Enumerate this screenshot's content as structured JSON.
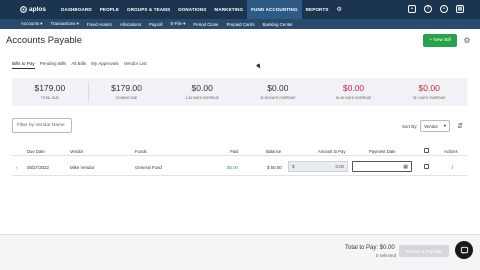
{
  "brand": {
    "name": "aplos"
  },
  "topnav": {
    "items": [
      "DASHBOARD",
      "PEOPLE",
      "GROUPS & TEAMS",
      "DONATIONS",
      "MARKETING",
      "FUND ACCOUNTING",
      "REPORTS"
    ],
    "active": "FUND ACCOUNTING",
    "right_icons": [
      "plus-icon",
      "help-icon",
      "user-icon",
      "grid-icon"
    ]
  },
  "subnav": {
    "items": [
      "Accounts ▾",
      "Transactions ▾",
      "Fixed Assets",
      "Allocations",
      "Payroll",
      "E-File ▾",
      "Period Close",
      "Prepaid Cards",
      "Banking Center"
    ]
  },
  "page": {
    "title": "Accounts Payable",
    "new_bill_label": "+ New Bill"
  },
  "tabs": [
    "Bills to Pay",
    "Pending Bills",
    "All Bills",
    "My Approvals",
    "Vendor List"
  ],
  "active_tab": "Bills to Pay",
  "summary": [
    {
      "value": "$179.00",
      "label": "TOTAL DUE",
      "color": "#333333"
    },
    {
      "value": "$179.00",
      "label": "COMING DUE",
      "color": "#333333"
    },
    {
      "value": "$0.00",
      "label": "1-30 DAYS OVERDUE",
      "color": "#333333"
    },
    {
      "value": "$0.00",
      "label": "31-60 DAYS OVERDUE",
      "color": "#333333"
    },
    {
      "value": "$0.00",
      "label": "61-90 DAYS OVERDUE",
      "color": "#d4213d"
    },
    {
      "value": "$0.00",
      "label": "91+ DAYS OVERDUE",
      "color": "#d4213d"
    }
  ],
  "filter": {
    "placeholder": "Filter by Vendor Name"
  },
  "sort": {
    "label": "Sort By:",
    "value": "Vendor"
  },
  "table": {
    "columns": [
      "Due Date",
      "Vendor",
      "Funds",
      "Paid",
      "Balance",
      "Amount to Pay",
      "Payment Date",
      "Actions"
    ],
    "rows": [
      {
        "due_date": "05/27/2022",
        "vendor": "Mike Vendor",
        "funds": "General Fund",
        "paid": "$0.00",
        "balance": "$ 50.00",
        "amount_prefix": "$",
        "amount": "0.00",
        "payment_date": ""
      }
    ]
  },
  "footer": {
    "total_label": "Total to Pay: $0.00",
    "selected_label": "0 selected",
    "review_button": "Review & Pay Bills"
  },
  "colors": {
    "nav_bg": "#1b3550",
    "accent_green": "#27a34a",
    "alert_red": "#d4213d"
  }
}
